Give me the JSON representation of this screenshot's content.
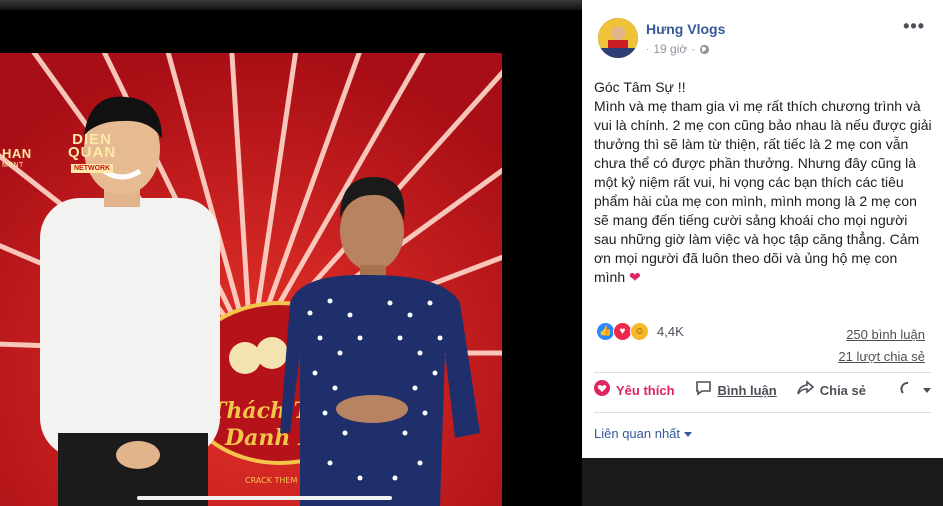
{
  "media": {
    "watermark_left": "HAN",
    "watermark_left_sub": "MENT",
    "logo_line1": "DIEN",
    "logo_line2": "QUAN",
    "logo_line3": "NETWORK",
    "stage_title_1": "Thách Thức",
    "stage_title_2": "Danh Hài",
    "stage_sub": "CRACK THEM UP",
    "colors": {
      "stage_red": "#c8161d",
      "stage_light": "#ffd3c2",
      "gold": "#f3c54a"
    }
  },
  "post": {
    "author": "Hưng Vlogs",
    "time": "19 giờ",
    "more": "•••",
    "body_title": "Góc Tâm Sự !!",
    "body_text": "Mình và mẹ tham gia vì mẹ rất thích chương trình và vui là chính. 2 mẹ con cũng bảo nhau là nếu được giải thưởng thì sẽ làm từ thiện, rất tiếc là 2 mẹ con vẫn chưa thể có được phần thưởng. Nhưng đây cũng là một kỷ niệm rất vui, hi vọng các bạn thích các tiêu phẩm hài của mẹ con mình, mình mong là 2 mẹ con sẽ mang đến tiếng cười sảng khoái cho mọi người sau những giờ làm việc và học tập căng thẳng. Cảm ơn mọi người đã luôn theo dõi và ủng hộ mẹ con mình",
    "heart_emoji": "❤",
    "reaction_count": "4,4K",
    "comments": "250 bình luận",
    "shares": "21 lượt chia sẻ",
    "actions": {
      "like": "Yêu thích",
      "comment": "Bình luận",
      "share": "Chia sẻ"
    },
    "sort_label": "Liên quan nhất",
    "colors": {
      "link": "#365899",
      "love": "#e0245e",
      "muted": "#90949c"
    }
  }
}
